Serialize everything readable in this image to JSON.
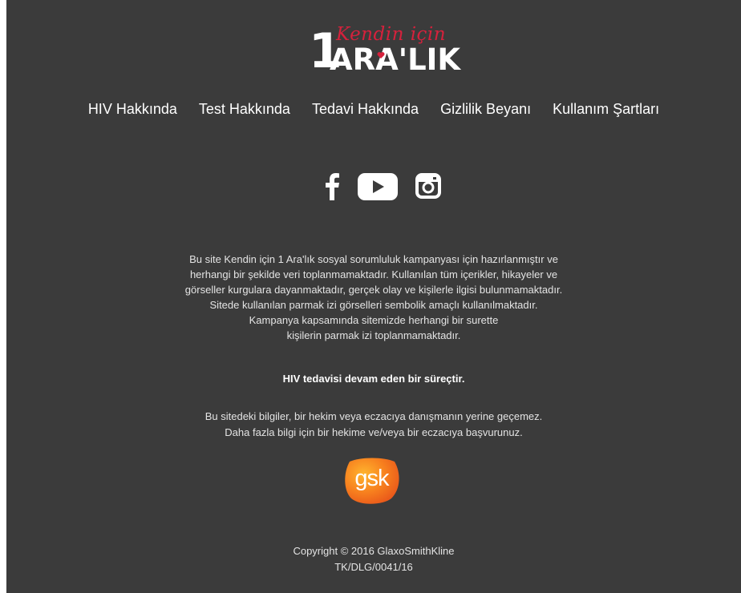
{
  "logo": {
    "script": "Kendin için",
    "one": "1",
    "word": "ARA'LIK",
    "script_color": "#d6213c"
  },
  "nav": [
    {
      "label": "HIV Hakkında"
    },
    {
      "label": "Test Hakkında"
    },
    {
      "label": "Tedavi Hakkında"
    },
    {
      "label": "Gizlilik Beyanı"
    },
    {
      "label": "Kullanım Şartları"
    }
  ],
  "social": {
    "icons": [
      "facebook-icon",
      "youtube-icon",
      "instagram-icon"
    ]
  },
  "disclaimer": {
    "lines": [
      "Bu site Kendin için 1 Ara'lık sosyal sorumluluk kampanyası için hazırlanmıştır ve",
      "herhangi bir şekilde veri toplanmamaktadır. Kullanılan tüm içerikler, hikayeler ve",
      "görseller kurgulara dayanmaktadır, gerçek olay ve kişilerle ilgisi bulunmamaktadır.",
      "Sitede kullanılan parmak izi görselleri sembolik amaçlı kullanılmaktadır.",
      "Kampanya kapsamında sitemizde herhangi bir surette",
      "kişilerin parmak izi toplanmamaktadır."
    ],
    "bold": "HIV tedavisi devam eden bir süreçtir.",
    "advice": [
      "Bu sitedeki bilgiler, bir hekim veya eczacıya danışmanın yerine geçemez.",
      "Daha fazla bilgi için bir hekime ve/veya bir eczacıya başvurunuz."
    ]
  },
  "gsk_logo": {
    "text": "gsk",
    "color": "#f36f21"
  },
  "copyright": {
    "line1": "Copyright © 2016 GlaxoSmithKline",
    "line2": "TK/DLG/0041/16"
  },
  "colors": {
    "background": "#3b3b3b",
    "text": "#ffffff"
  }
}
